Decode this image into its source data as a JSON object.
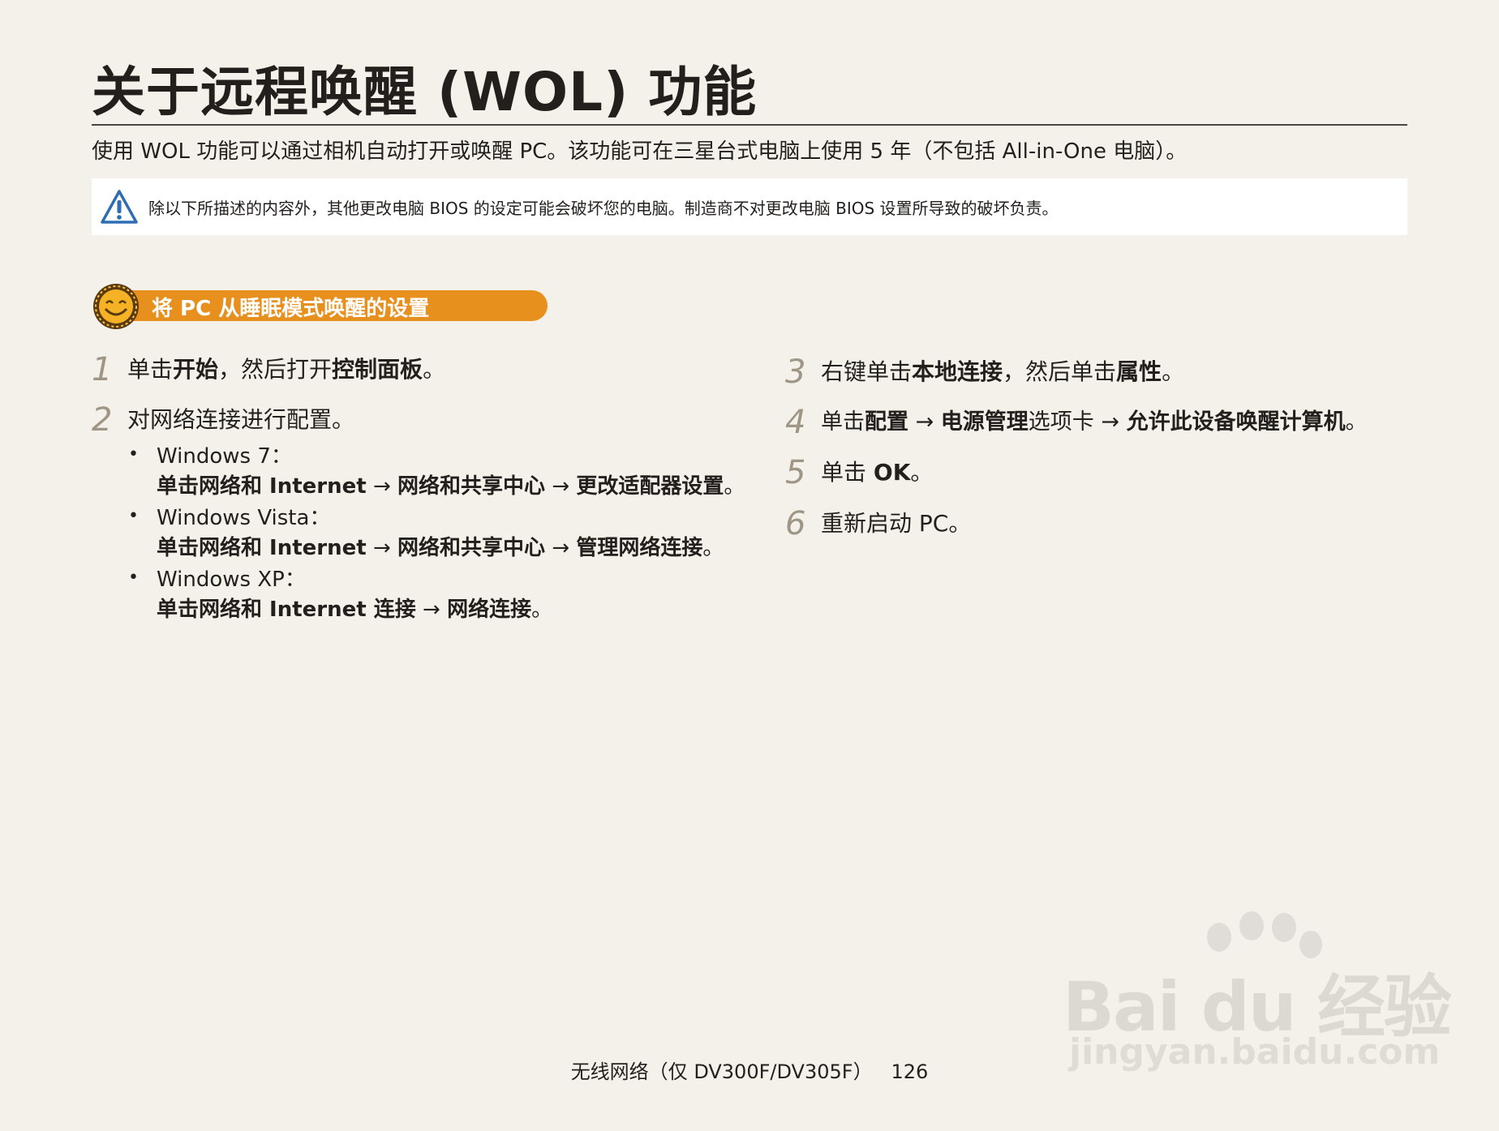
{
  "title": "关于远程唤醒 (WOL) 功能",
  "intro": "使用 WOL 功能可以通过相机自动打开或唤醒 PC。该功能可在三星台式电脑上使用 5 年（不包括 All-in-One 电脑）。",
  "warning": "除以下所描述的内容外，其他更改电脑 BIOS 的设定可能会破坏您的电脑。制造商不对更改电脑 BIOS 设置所导致的破坏负责。",
  "section_label": "将 PC 从睡眠模式唤醒的设置",
  "icons": {
    "warning": "warning-triangle-icon",
    "section": "smiling-sun-icon"
  },
  "colors": {
    "background": "#f4f1eb",
    "badge": "#e8901e",
    "step_number": "#9e9585"
  },
  "steps": {
    "s1": {
      "num": "1",
      "p1": "单击",
      "b1": "开始",
      "p2": "，然后打开",
      "b2": "控制面板",
      "p3": "。"
    },
    "s2": {
      "num": "2",
      "text": "对网络连接进行配置。",
      "win7_label": "Windows 7：",
      "win7_b1": "单击网络和 Internet",
      "win7_a1": "→",
      "win7_b2": "网络和共享中心",
      "win7_a2": "→",
      "win7_b3": "更改适配器设置",
      "win7_end": "。",
      "vista_label": "Windows Vista：",
      "vista_b1": "单击网络和 Internet",
      "vista_a1": "→",
      "vista_b2": "网络和共享中心",
      "vista_a2": "→",
      "vista_b3": "管理网络连接",
      "vista_end": "。",
      "xp_label": "Windows XP：",
      "xp_b1": "单击网络和 Internet 连接",
      "xp_a1": "→",
      "xp_b2": "网络连接",
      "xp_end": "。",
      "bullet": "•"
    },
    "s3": {
      "num": "3",
      "p1": "右键单击",
      "b1": "本地连接",
      "p2": "，然后单击",
      "b2": "属性",
      "p3": "。"
    },
    "s4": {
      "num": "4",
      "p1": "单击",
      "b1": "配置",
      "a1": " → ",
      "b2": "电源管理",
      "p2": "选项卡",
      "a2": " → ",
      "b3": "允许此设备唤醒计算机",
      "p3": "。"
    },
    "s5": {
      "num": "5",
      "p1": "单击 ",
      "b1": "OK",
      "p2": "。"
    },
    "s6": {
      "num": "6",
      "text": "重新启动 PC。"
    }
  },
  "footer": {
    "section": "无线网络（仅 DV300F/DV305F）",
    "page": "126"
  },
  "watermark": {
    "main": "Bai du 经验",
    "sub": "jingyan.baidu.com"
  }
}
